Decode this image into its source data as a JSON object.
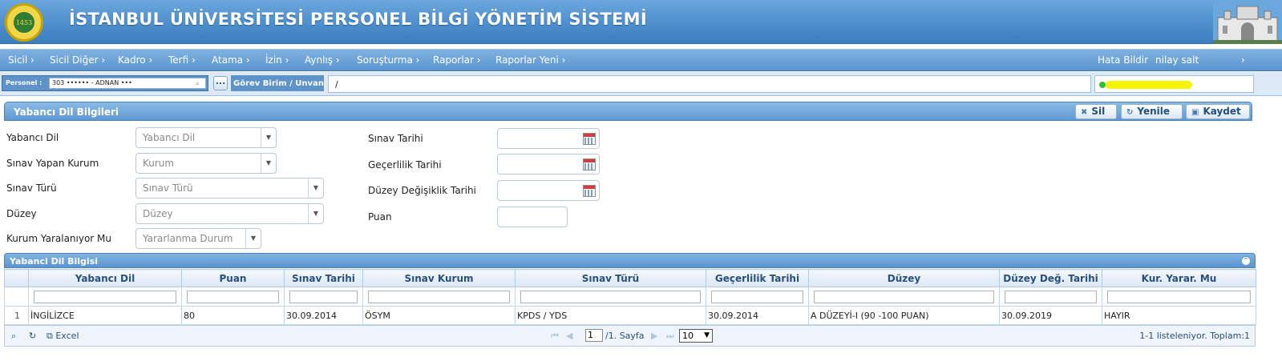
{
  "header": {
    "title": "İSTANBUL ÜNİVERSİTESİ PERSONEL BİLGİ YÖNETİM SİSTEMİ",
    "logo_text": "1453"
  },
  "menu": {
    "items": [
      "Sicil",
      "Sicil Diğer",
      "Kadro",
      "Terfi",
      "Atama",
      "İzin",
      "Aynlış",
      "Soruşturma",
      "Raporlar",
      "Raporlar Yeni"
    ],
    "right": [
      "Hata Bildir",
      "nilay salt"
    ]
  },
  "personel_bar": {
    "label": "Personel :",
    "value": "303 •••••• - ADNAN •••",
    "more_button": "...",
    "gorev_label": "Görev Birim / Unvan :",
    "gorev_value": "/"
  },
  "panel": {
    "title": "Yabancı Dil Bilgileri",
    "buttons": {
      "sil": "Sil",
      "yenile": "Yenile",
      "kaydet": "Kaydet"
    }
  },
  "form": {
    "yabanci_dil": {
      "label": "Yabancı Dil",
      "placeholder": "Yabancı Dil"
    },
    "sinav_kurum": {
      "label": "Sınav Yapan Kurum",
      "placeholder": "Kurum"
    },
    "sinav_turu": {
      "label": "Sınav Türü",
      "placeholder": "Sınav Türü"
    },
    "duzey": {
      "label": "Düzey",
      "placeholder": "Düzey"
    },
    "kurum_yararlaniyor": {
      "label": "Kurum Yaralanıyor Mu",
      "placeholder": "Yararlanma Durum"
    },
    "sinav_tarihi": {
      "label": "Sınav Tarihi"
    },
    "gecerlilik_tarihi": {
      "label": "Geçerlilik Tarihi"
    },
    "duzey_degisiklik_tarihi": {
      "label": "Düzey Değişiklik Tarihi"
    },
    "puan": {
      "label": "Puan"
    }
  },
  "grid": {
    "title": "Yabanci Dil Bilgisi",
    "columns": [
      "Yabancı Dil",
      "Puan",
      "Sınav Tarihi",
      "Sınav Kurum",
      "Sınav Türü",
      "Geçerlilik Tarihi",
      "Düzey",
      "Düzey Değ. Tarihi",
      "Kur. Yarar. Mu"
    ],
    "rows": [
      {
        "no": "1",
        "cells": [
          "İNGİLİZCE",
          "80",
          "30.09.2014",
          "ÖSYM",
          "KPDS / YDS",
          "30.09.2014",
          "A DÜZEYİ-I (90 -100 PUAN)",
          "30.09.2019",
          "HAYIR"
        ]
      }
    ]
  },
  "pager": {
    "excel": "Excel",
    "page_value": "1",
    "page_text": "/1. Sayfa",
    "page_size": "10",
    "summary": "1-1 listeleniyor. Toplam:1"
  }
}
